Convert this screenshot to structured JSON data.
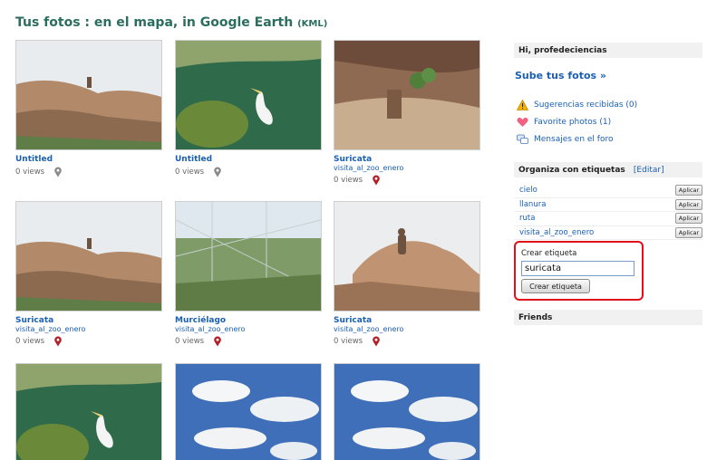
{
  "header": {
    "title_part1": "Tus fotos : en el mapa, in Google Earth",
    "title_kml": "(KML)"
  },
  "photos": [
    {
      "title": "Untitled",
      "tag": "",
      "views": "0 views",
      "pin": "gray",
      "scene": "rock"
    },
    {
      "title": "Untitled",
      "tag": "",
      "views": "0 views",
      "pin": "gray",
      "scene": "pelican"
    },
    {
      "title": "Suricata",
      "tag": "visita_al_zoo_enero",
      "views": "0 views",
      "pin": "red",
      "scene": "enclosure"
    },
    {
      "title": "Suricata",
      "tag": "visita_al_zoo_enero",
      "views": "0 views",
      "pin": "red",
      "scene": "rock"
    },
    {
      "title": "Murciélago",
      "tag": "visita_al_zoo_enero",
      "views": "0 views",
      "pin": "red",
      "scene": "fence"
    },
    {
      "title": "Suricata",
      "tag": "visita_al_zoo_enero",
      "views": "0 views",
      "pin": "red",
      "scene": "meerkat"
    },
    {
      "title": "",
      "tag": "",
      "views": "",
      "pin": "",
      "scene": "pelican"
    },
    {
      "title": "",
      "tag": "",
      "views": "",
      "pin": "",
      "scene": "sky"
    },
    {
      "title": "",
      "tag": "",
      "views": "",
      "pin": "",
      "scene": "sky"
    }
  ],
  "sidebar": {
    "greeting": "Hi, profedeciencias",
    "upload": "Sube tus fotos »",
    "links": [
      {
        "label": "Sugerencias recibidas (0)",
        "icon": "warning-icon"
      },
      {
        "label": "Favorite photos (1)",
        "icon": "heart-icon"
      },
      {
        "label": "Mensajes en el foro",
        "icon": "chat-icon"
      }
    ],
    "tags_header": "Organiza con etiquetas",
    "tags_edit": "[Editar]",
    "tags": [
      {
        "name": "cielo",
        "button": "Aplicar"
      },
      {
        "name": "llanura",
        "button": "Aplicar"
      },
      {
        "name": "ruta",
        "button": "Aplicar"
      },
      {
        "name": "visita_al_zoo_enero",
        "button": "Aplicar"
      }
    ],
    "create_label": "Crear etiqueta",
    "create_value": "suricata",
    "create_button": "Crear etiqueta",
    "friends": "Friends"
  },
  "colors": {
    "title": "#2b6d5e",
    "link": "#1a5fb4",
    "highlight_border": "#e0101a"
  }
}
